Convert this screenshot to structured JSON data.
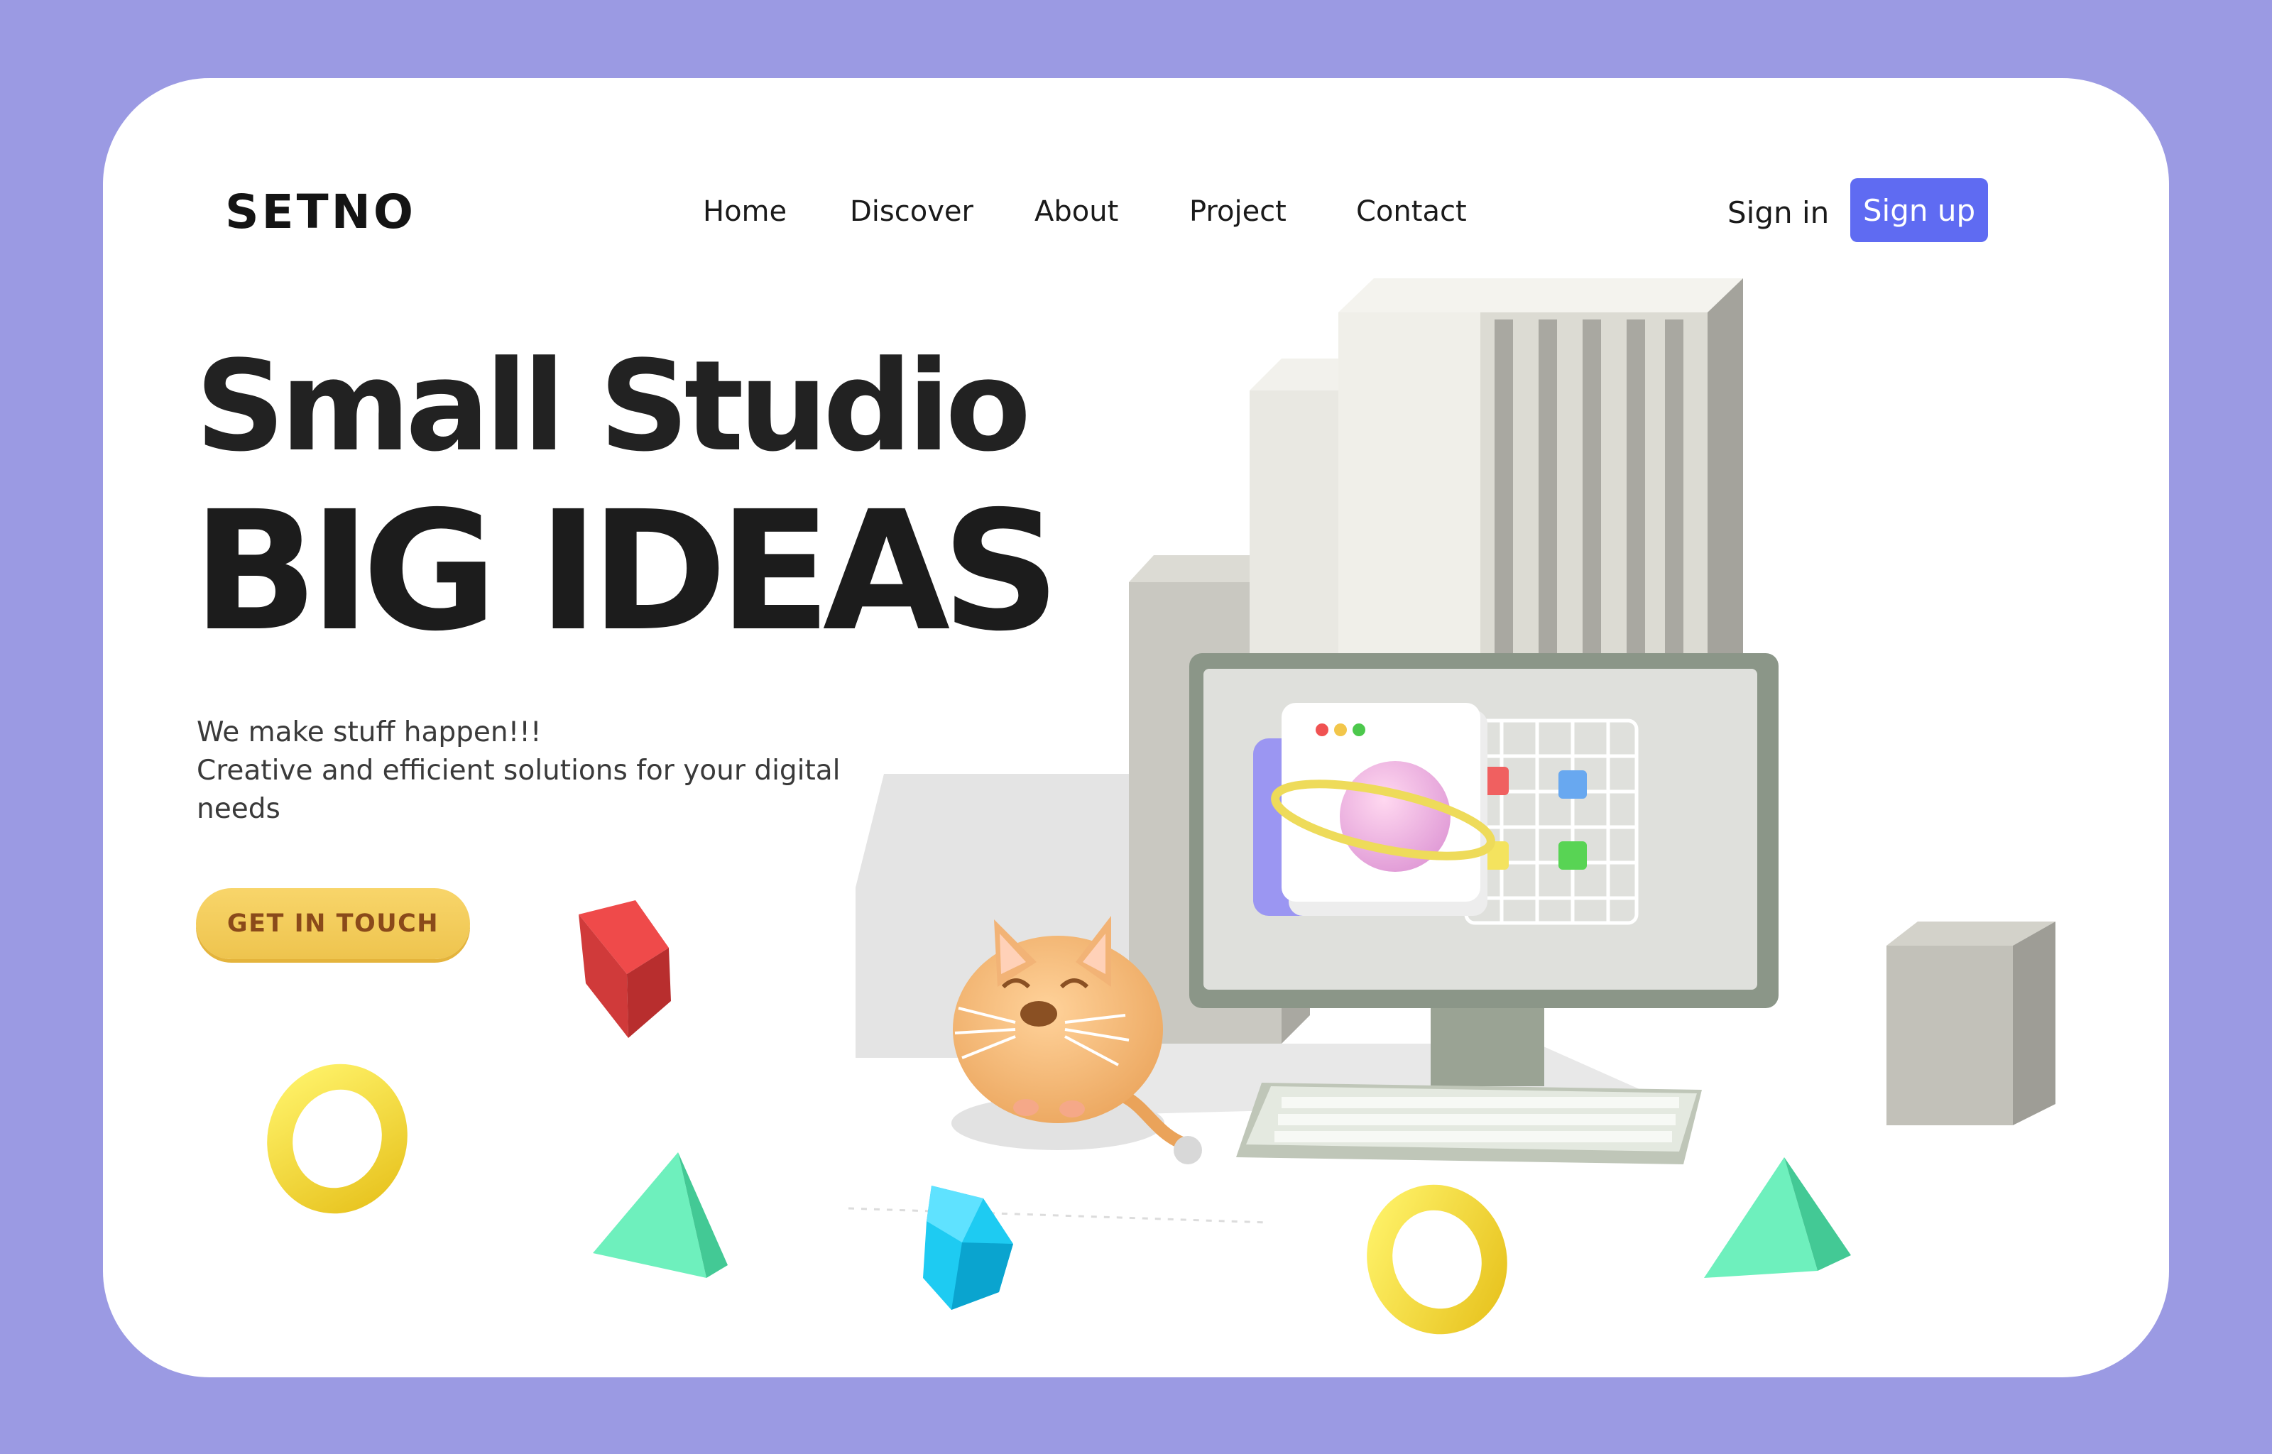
{
  "brand": {
    "logo": "SETNO"
  },
  "nav": {
    "items": [
      {
        "label": "Home"
      },
      {
        "label": "Discover"
      },
      {
        "label": "About"
      },
      {
        "label": "Project"
      },
      {
        "label": "Contact"
      }
    ]
  },
  "auth": {
    "signin": "Sign in",
    "signup": "Sign up"
  },
  "hero": {
    "title_line1": "Small Studio",
    "title_line2": "BIG IDEAS",
    "tagline_line1": "We make stuff happen!!!",
    "tagline_line2": "Creative and efficient solutions for your digital needs",
    "cta": "GET IN TOUCH"
  },
  "colors": {
    "background": "#9b9ae3",
    "card": "#ffffff",
    "signup_button": "#5f6bf2",
    "cta_button": "#f3cd5c"
  }
}
